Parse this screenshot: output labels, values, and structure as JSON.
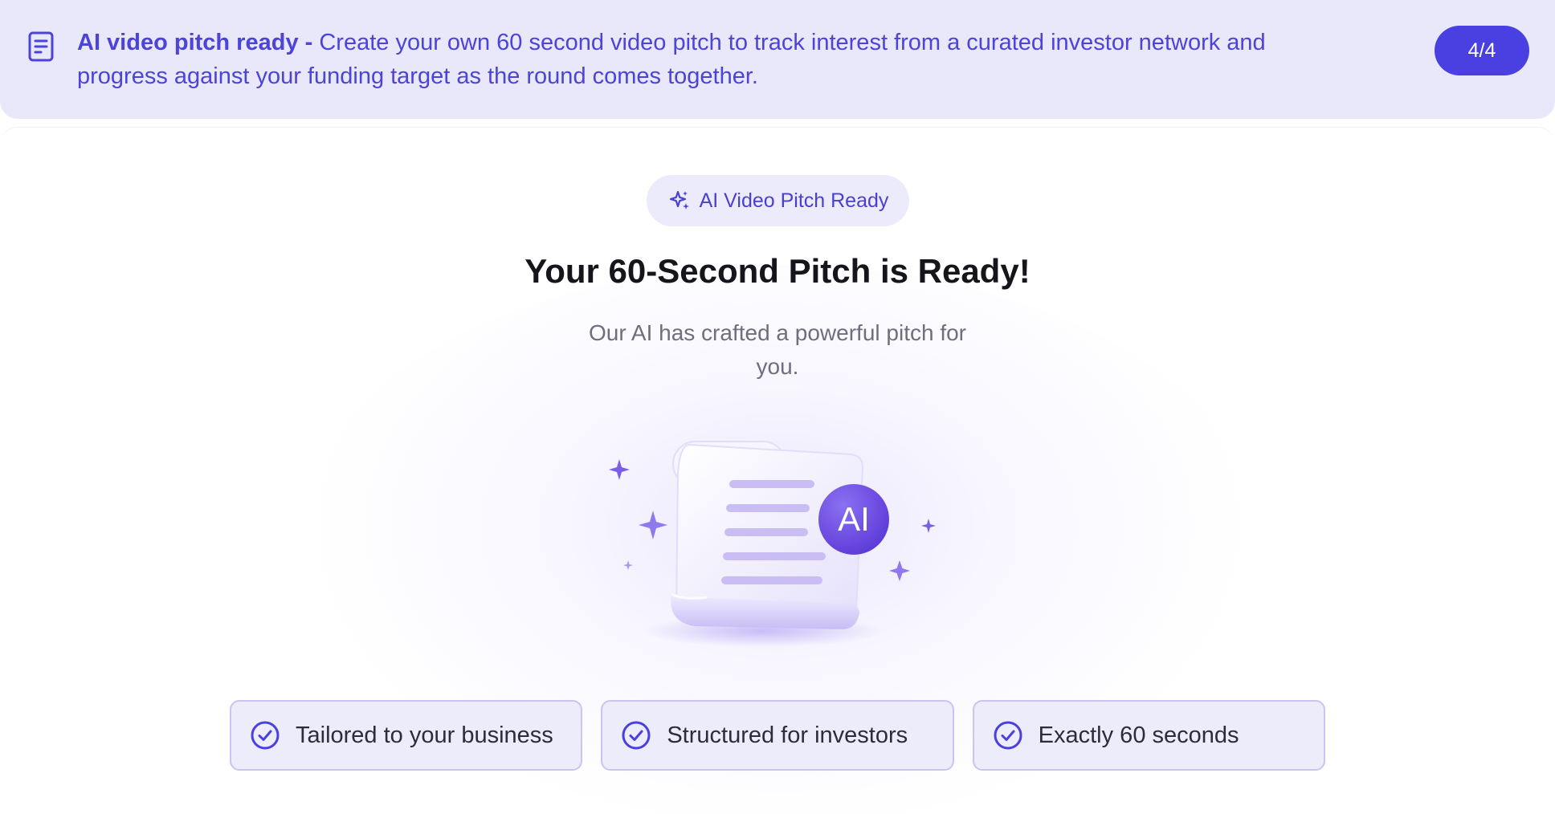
{
  "banner": {
    "icon": "document-icon",
    "lead": "AI video pitch ready - ",
    "text": "Create your own 60 second video pitch to track interest from a curated investor network and progress against your funding target as the round comes together.",
    "step": "4/4"
  },
  "hero": {
    "badge_icon": "sparkles-icon",
    "badge": "AI Video Pitch Ready",
    "title": "Your 60-Second Pitch is Ready!",
    "subtitle": "Our AI has crafted a powerful pitch for you.",
    "illustration_badge": "AI"
  },
  "features": [
    {
      "icon": "check-circle-icon",
      "label": "Tailored to your business"
    },
    {
      "icon": "check-circle-icon",
      "label": "Structured for investors"
    },
    {
      "icon": "check-circle-icon",
      "label": "Exactly 60 seconds"
    }
  ],
  "colors": {
    "accent": "#4a3fe0",
    "banner_bg": "#e9e8fb",
    "chip_bg": "#edecfb",
    "chip_border": "#c9c4f1",
    "title": "#16151c",
    "muted": "#6f6d7e"
  }
}
